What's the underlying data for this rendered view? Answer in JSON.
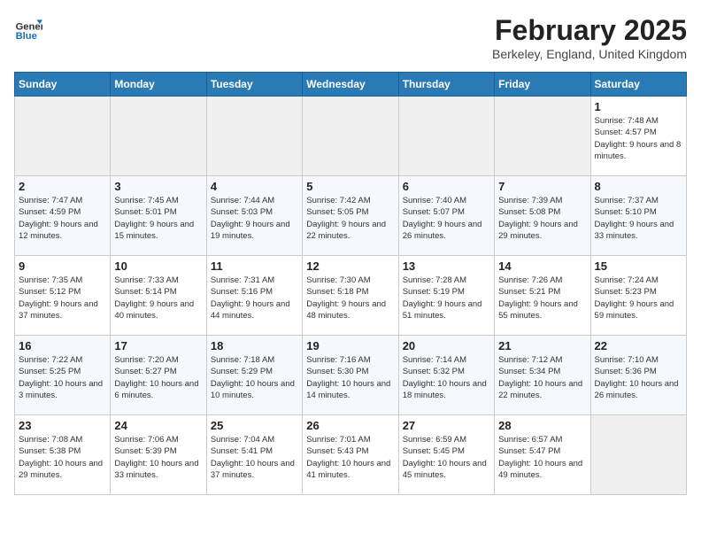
{
  "header": {
    "logo_general": "General",
    "logo_blue": "Blue",
    "main_title": "February 2025",
    "subtitle": "Berkeley, England, United Kingdom"
  },
  "days_of_week": [
    "Sunday",
    "Monday",
    "Tuesday",
    "Wednesday",
    "Thursday",
    "Friday",
    "Saturday"
  ],
  "weeks": [
    [
      {
        "num": "",
        "info": ""
      },
      {
        "num": "",
        "info": ""
      },
      {
        "num": "",
        "info": ""
      },
      {
        "num": "",
        "info": ""
      },
      {
        "num": "",
        "info": ""
      },
      {
        "num": "",
        "info": ""
      },
      {
        "num": "1",
        "info": "Sunrise: 7:48 AM\nSunset: 4:57 PM\nDaylight: 9 hours and 8 minutes."
      }
    ],
    [
      {
        "num": "2",
        "info": "Sunrise: 7:47 AM\nSunset: 4:59 PM\nDaylight: 9 hours and 12 minutes."
      },
      {
        "num": "3",
        "info": "Sunrise: 7:45 AM\nSunset: 5:01 PM\nDaylight: 9 hours and 15 minutes."
      },
      {
        "num": "4",
        "info": "Sunrise: 7:44 AM\nSunset: 5:03 PM\nDaylight: 9 hours and 19 minutes."
      },
      {
        "num": "5",
        "info": "Sunrise: 7:42 AM\nSunset: 5:05 PM\nDaylight: 9 hours and 22 minutes."
      },
      {
        "num": "6",
        "info": "Sunrise: 7:40 AM\nSunset: 5:07 PM\nDaylight: 9 hours and 26 minutes."
      },
      {
        "num": "7",
        "info": "Sunrise: 7:39 AM\nSunset: 5:08 PM\nDaylight: 9 hours and 29 minutes."
      },
      {
        "num": "8",
        "info": "Sunrise: 7:37 AM\nSunset: 5:10 PM\nDaylight: 9 hours and 33 minutes."
      }
    ],
    [
      {
        "num": "9",
        "info": "Sunrise: 7:35 AM\nSunset: 5:12 PM\nDaylight: 9 hours and 37 minutes."
      },
      {
        "num": "10",
        "info": "Sunrise: 7:33 AM\nSunset: 5:14 PM\nDaylight: 9 hours and 40 minutes."
      },
      {
        "num": "11",
        "info": "Sunrise: 7:31 AM\nSunset: 5:16 PM\nDaylight: 9 hours and 44 minutes."
      },
      {
        "num": "12",
        "info": "Sunrise: 7:30 AM\nSunset: 5:18 PM\nDaylight: 9 hours and 48 minutes."
      },
      {
        "num": "13",
        "info": "Sunrise: 7:28 AM\nSunset: 5:19 PM\nDaylight: 9 hours and 51 minutes."
      },
      {
        "num": "14",
        "info": "Sunrise: 7:26 AM\nSunset: 5:21 PM\nDaylight: 9 hours and 55 minutes."
      },
      {
        "num": "15",
        "info": "Sunrise: 7:24 AM\nSunset: 5:23 PM\nDaylight: 9 hours and 59 minutes."
      }
    ],
    [
      {
        "num": "16",
        "info": "Sunrise: 7:22 AM\nSunset: 5:25 PM\nDaylight: 10 hours and 3 minutes."
      },
      {
        "num": "17",
        "info": "Sunrise: 7:20 AM\nSunset: 5:27 PM\nDaylight: 10 hours and 6 minutes."
      },
      {
        "num": "18",
        "info": "Sunrise: 7:18 AM\nSunset: 5:29 PM\nDaylight: 10 hours and 10 minutes."
      },
      {
        "num": "19",
        "info": "Sunrise: 7:16 AM\nSunset: 5:30 PM\nDaylight: 10 hours and 14 minutes."
      },
      {
        "num": "20",
        "info": "Sunrise: 7:14 AM\nSunset: 5:32 PM\nDaylight: 10 hours and 18 minutes."
      },
      {
        "num": "21",
        "info": "Sunrise: 7:12 AM\nSunset: 5:34 PM\nDaylight: 10 hours and 22 minutes."
      },
      {
        "num": "22",
        "info": "Sunrise: 7:10 AM\nSunset: 5:36 PM\nDaylight: 10 hours and 26 minutes."
      }
    ],
    [
      {
        "num": "23",
        "info": "Sunrise: 7:08 AM\nSunset: 5:38 PM\nDaylight: 10 hours and 29 minutes."
      },
      {
        "num": "24",
        "info": "Sunrise: 7:06 AM\nSunset: 5:39 PM\nDaylight: 10 hours and 33 minutes."
      },
      {
        "num": "25",
        "info": "Sunrise: 7:04 AM\nSunset: 5:41 PM\nDaylight: 10 hours and 37 minutes."
      },
      {
        "num": "26",
        "info": "Sunrise: 7:01 AM\nSunset: 5:43 PM\nDaylight: 10 hours and 41 minutes."
      },
      {
        "num": "27",
        "info": "Sunrise: 6:59 AM\nSunset: 5:45 PM\nDaylight: 10 hours and 45 minutes."
      },
      {
        "num": "28",
        "info": "Sunrise: 6:57 AM\nSunset: 5:47 PM\nDaylight: 10 hours and 49 minutes."
      },
      {
        "num": "",
        "info": ""
      }
    ]
  ]
}
